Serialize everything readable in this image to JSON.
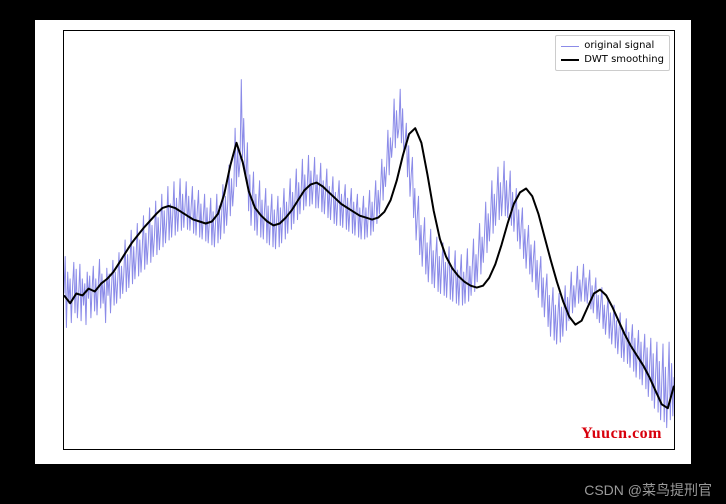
{
  "chart_data": {
    "type": "line",
    "title": "",
    "xlabel": "",
    "ylabel": "",
    "xlim": [
      0,
      500
    ],
    "ylim": [
      -1.2,
      3.1
    ],
    "grid": false,
    "legend_position": "upper-right",
    "series": [
      {
        "name": "original signal",
        "color": "#8b8be8",
        "linewidth": 1,
        "x_start": 0,
        "x_end": 500,
        "n": 500,
        "values": [
          0.4,
          0.78,
          0.05,
          0.62,
          0.3,
          0.55,
          0.1,
          0.48,
          0.72,
          0.2,
          0.65,
          0.15,
          0.4,
          0.7,
          0.12,
          0.55,
          0.28,
          0.5,
          0.08,
          0.62,
          0.35,
          0.58,
          0.15,
          0.45,
          0.68,
          0.22,
          0.55,
          0.18,
          0.48,
          0.75,
          0.25,
          0.6,
          0.3,
          0.52,
          0.1,
          0.66,
          0.38,
          0.6,
          0.2,
          0.5,
          0.74,
          0.28,
          0.62,
          0.3,
          0.55,
          0.82,
          0.35,
          0.68,
          0.4,
          0.62,
          0.95,
          0.42,
          0.8,
          0.46,
          0.72,
          1.05,
          0.5,
          0.88,
          0.55,
          0.78,
          1.12,
          0.58,
          0.95,
          0.62,
          0.85,
          1.2,
          0.65,
          1.02,
          0.7,
          0.92,
          1.28,
          0.72,
          1.1,
          0.78,
          1.0,
          1.35,
          0.8,
          1.18,
          0.85,
          1.08,
          1.42,
          0.88,
          1.25,
          0.92,
          1.15,
          1.5,
          0.95,
          1.32,
          0.98,
          1.22,
          1.55,
          1.0,
          1.38,
          1.04,
          1.28,
          1.58,
          1.05,
          1.42,
          1.08,
          1.3,
          1.55,
          1.06,
          1.4,
          1.05,
          1.28,
          1.5,
          1.02,
          1.36,
          1.0,
          1.24,
          1.46,
          0.98,
          1.32,
          0.96,
          1.2,
          1.42,
          0.94,
          1.28,
          0.92,
          1.16,
          1.38,
          0.9,
          1.24,
          0.88,
          1.14,
          1.42,
          0.92,
          1.3,
          0.96,
          1.22,
          1.52,
          1.02,
          1.4,
          1.1,
          1.34,
          1.72,
          1.2,
          1.58,
          1.3,
          1.5,
          2.1,
          1.5,
          1.9,
          1.6,
          1.75,
          2.6,
          1.8,
          2.2,
          1.7,
          1.6,
          1.95,
          1.25,
          1.62,
          1.1,
          1.4,
          1.65,
          1.05,
          1.42,
          1.0,
          1.32,
          1.56,
          0.98,
          1.36,
          0.96,
          1.26,
          1.48,
          0.92,
          1.3,
          0.9,
          1.2,
          1.42,
          0.88,
          1.26,
          0.86,
          1.16,
          1.4,
          0.88,
          1.28,
          0.92,
          1.22,
          1.48,
          0.96,
          1.34,
          1.02,
          1.3,
          1.58,
          1.06,
          1.44,
          1.12,
          1.38,
          1.68,
          1.16,
          1.54,
          1.22,
          1.46,
          1.78,
          1.26,
          1.62,
          1.3,
          1.52,
          1.82,
          1.3,
          1.66,
          1.32,
          1.54,
          1.8,
          1.28,
          1.62,
          1.28,
          1.5,
          1.74,
          1.24,
          1.56,
          1.22,
          1.46,
          1.68,
          1.18,
          1.5,
          1.16,
          1.4,
          1.6,
          1.12,
          1.44,
          1.1,
          1.36,
          1.56,
          1.1,
          1.42,
          1.08,
          1.34,
          1.52,
          1.06,
          1.38,
          1.04,
          1.3,
          1.48,
          1.02,
          1.34,
          1.0,
          1.26,
          1.42,
          0.98,
          1.28,
          0.96,
          1.22,
          1.4,
          0.96,
          1.28,
          0.98,
          1.26,
          1.46,
          1.0,
          1.34,
          1.04,
          1.32,
          1.56,
          1.12,
          1.46,
          1.22,
          1.48,
          1.78,
          1.36,
          1.7,
          1.5,
          1.72,
          2.08,
          1.62,
          2.0,
          1.8,
          1.98,
          2.4,
          1.9,
          2.28,
          2.0,
          2.1,
          2.5,
          1.95,
          2.3,
          1.85,
          1.95,
          2.15,
          1.6,
          1.92,
          1.4,
          1.62,
          1.8,
          1.18,
          1.48,
          0.95,
          1.2,
          1.4,
          0.8,
          1.1,
          0.68,
          0.96,
          1.18,
          0.6,
          0.92,
          0.52,
          0.82,
          1.06,
          0.5,
          0.84,
          0.46,
          0.76,
          0.98,
          0.42,
          0.78,
          0.4,
          0.7,
          0.92,
          0.38,
          0.72,
          0.36,
          0.66,
          0.88,
          0.34,
          0.68,
          0.32,
          0.62,
          0.84,
          0.3,
          0.64,
          0.28,
          0.58,
          0.8,
          0.28,
          0.62,
          0.3,
          0.6,
          0.86,
          0.32,
          0.68,
          0.38,
          0.68,
          0.96,
          0.42,
          0.8,
          0.52,
          0.82,
          1.12,
          0.6,
          0.98,
          0.72,
          1.0,
          1.34,
          0.82,
          1.22,
          0.94,
          1.2,
          1.56,
          1.02,
          1.42,
          1.1,
          1.36,
          1.7,
          1.16,
          1.54,
          1.2,
          1.44,
          1.76,
          1.2,
          1.56,
          1.18,
          1.4,
          1.66,
          1.1,
          1.44,
          1.04,
          1.28,
          1.48,
          0.94,
          1.26,
          0.86,
          1.1,
          1.28,
          0.76,
          1.06,
          0.66,
          0.92,
          1.1,
          0.6,
          0.9,
          0.52,
          0.76,
          0.94,
          0.44,
          0.74,
          0.36,
          0.6,
          0.78,
          0.26,
          0.56,
          0.16,
          0.42,
          0.6,
          0.06,
          0.38,
          -0.04,
          0.26,
          0.46,
          -0.08,
          0.28,
          -0.12,
          0.18,
          0.4,
          -0.1,
          0.26,
          -0.04,
          0.24,
          0.48,
          0.02,
          0.36,
          0.12,
          0.38,
          0.62,
          0.2,
          0.48,
          0.26,
          0.46,
          0.68,
          0.3,
          0.54,
          0.32,
          0.5,
          0.7,
          0.32,
          0.56,
          0.3,
          0.48,
          0.64,
          0.24,
          0.48,
          0.2,
          0.4,
          0.56,
          0.14,
          0.38,
          0.1,
          0.3,
          0.46,
          0.04,
          0.28,
          -0.02,
          0.2,
          0.36,
          -0.06,
          0.2,
          -0.12,
          0.1,
          0.28,
          -0.16,
          0.12,
          -0.22,
          0.02,
          0.2,
          -0.26,
          0.04,
          -0.3,
          -0.04,
          0.14,
          -0.32,
          0.0,
          -0.36,
          -0.1,
          0.08,
          -0.4,
          -0.06,
          -0.46,
          -0.18,
          0.02,
          -0.48,
          -0.1,
          -0.54,
          -0.26,
          -0.02,
          -0.58,
          -0.16,
          -0.66,
          -0.34,
          -0.06,
          -0.7,
          -0.22,
          -0.78,
          -0.42,
          -0.1,
          -0.82,
          -0.3,
          -0.9,
          -0.5,
          -0.12,
          -0.92,
          -0.36,
          -0.98,
          -0.56,
          -0.1,
          -0.9,
          -0.32,
          -0.86,
          -0.46,
          0.0,
          -0.74,
          -0.18,
          -0.64,
          -0.26,
          0.14,
          -0.5,
          0.02
        ]
      },
      {
        "name": "DWT smoothing",
        "color": "#000000",
        "linewidth": 2,
        "x_start": 0,
        "x_end": 500,
        "n": 100,
        "values": [
          0.38,
          0.3,
          0.4,
          0.38,
          0.45,
          0.42,
          0.5,
          0.55,
          0.62,
          0.72,
          0.82,
          0.92,
          1.0,
          1.08,
          1.15,
          1.22,
          1.28,
          1.3,
          1.28,
          1.24,
          1.2,
          1.16,
          1.14,
          1.12,
          1.14,
          1.22,
          1.42,
          1.72,
          1.95,
          1.75,
          1.45,
          1.28,
          1.2,
          1.14,
          1.1,
          1.12,
          1.18,
          1.26,
          1.36,
          1.46,
          1.52,
          1.54,
          1.5,
          1.44,
          1.38,
          1.32,
          1.28,
          1.24,
          1.2,
          1.18,
          1.16,
          1.18,
          1.24,
          1.36,
          1.56,
          1.82,
          2.04,
          2.1,
          1.95,
          1.62,
          1.25,
          0.96,
          0.78,
          0.66,
          0.58,
          0.52,
          0.48,
          0.46,
          0.48,
          0.56,
          0.7,
          0.9,
          1.12,
          1.32,
          1.44,
          1.48,
          1.4,
          1.22,
          0.98,
          0.74,
          0.52,
          0.32,
          0.16,
          0.08,
          0.12,
          0.26,
          0.4,
          0.44,
          0.38,
          0.26,
          0.12,
          -0.02,
          -0.14,
          -0.24,
          -0.34,
          -0.46,
          -0.6,
          -0.74,
          -0.78,
          -0.55
        ]
      }
    ]
  },
  "legend": {
    "items": [
      {
        "label": "original signal",
        "color": "#8b8be8",
        "width": 1
      },
      {
        "label": "DWT smoothing",
        "color": "#000000",
        "width": 2
      }
    ]
  },
  "watermarks": {
    "red": "Yuucn.com",
    "gray": "CSDN @菜鸟提刑官"
  }
}
